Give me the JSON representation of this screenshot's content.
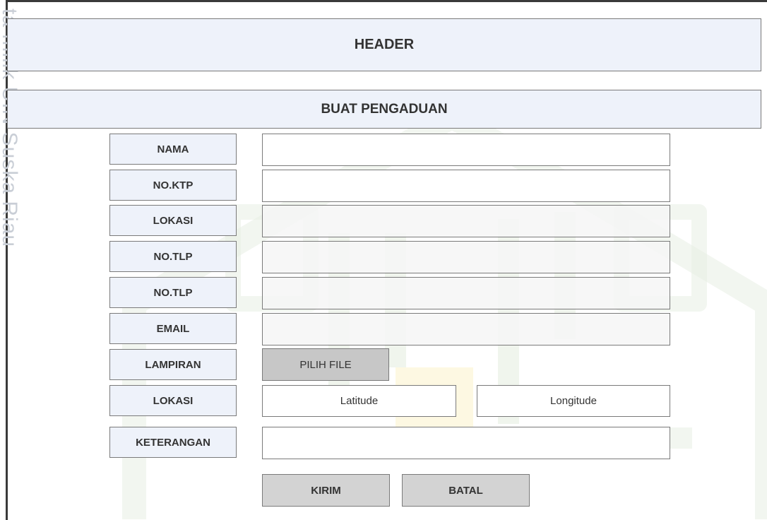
{
  "header": {
    "title": "HEADER"
  },
  "form": {
    "title": "BUAT PENGADUAN",
    "fields": [
      {
        "label": "NAMA",
        "value": ""
      },
      {
        "label": "NO.KTP",
        "value": ""
      },
      {
        "label": "LOKASI",
        "value": ""
      },
      {
        "label": "NO.TLP",
        "value": ""
      },
      {
        "label": "NO.TLP",
        "value": ""
      },
      {
        "label": "EMAIL",
        "value": ""
      },
      {
        "label": "LAMPIRAN",
        "button": "PILIH FILE"
      },
      {
        "label": "LOKASI",
        "latitude": "Latitude",
        "longitude": "Longitude"
      },
      {
        "label": "KETERANGAN",
        "value": ""
      }
    ],
    "actions": {
      "submit": "KIRIM",
      "cancel": "BATAL"
    }
  },
  "watermark": {
    "side_text": "ta milik UIN Suska Riau"
  },
  "colors": {
    "band_bg": "#eef2fa",
    "border": "#7a7a7a",
    "file_button": "#c7c7c7",
    "action_button": "#d3d3d3",
    "watermark_green": "#d9ead2",
    "watermark_yellow": "#fbf3cf"
  }
}
